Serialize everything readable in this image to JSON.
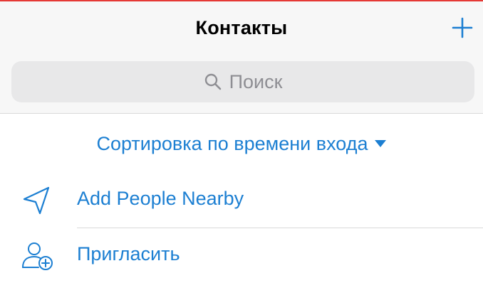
{
  "nav": {
    "title": "Контакты",
    "add_icon": "plus-icon"
  },
  "search": {
    "placeholder": "Поиск",
    "icon": "search-icon"
  },
  "sort": {
    "label": "Сортировка по времени входа",
    "icon": "caret-down-icon"
  },
  "list": {
    "items": [
      {
        "label": "Add People Nearby",
        "icon": "location-arrow-icon"
      },
      {
        "label": "Пригласить",
        "icon": "add-person-icon"
      }
    ]
  },
  "colors": {
    "accent": "#1c7fd2",
    "top_bar": "#e53935",
    "nav_background": "#f7f7f7",
    "search_background": "#e8e8e9",
    "placeholder_text": "#8e8e93"
  }
}
